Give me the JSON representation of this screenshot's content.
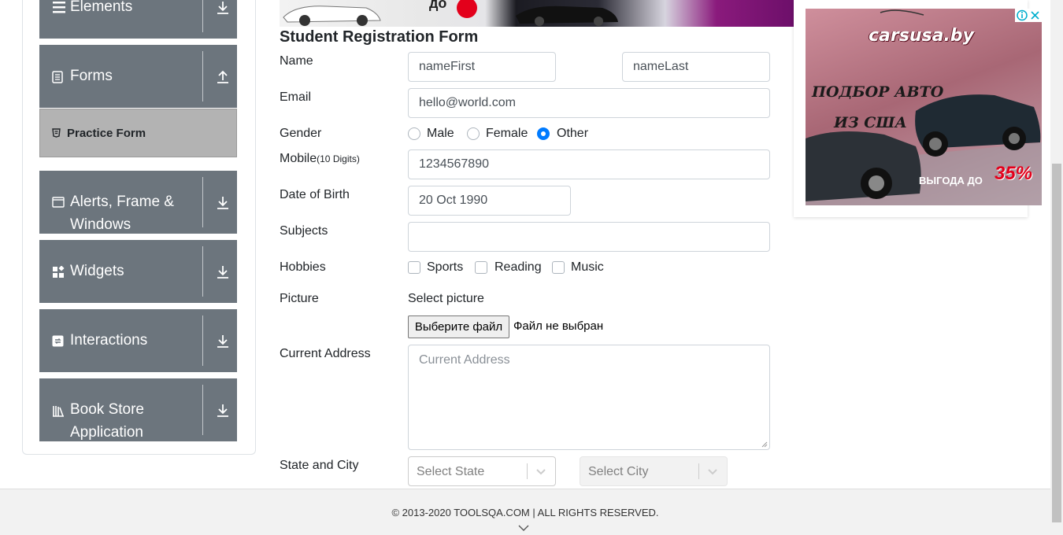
{
  "sidebar": {
    "groups": [
      {
        "label": "Elements",
        "icon": "menu-icon",
        "arrow": "download-arrow-icon"
      },
      {
        "label": "Forms",
        "icon": "document-icon",
        "arrow": "upload-arrow-icon"
      },
      {
        "label": "Alerts, Frame &",
        "label2": "Windows",
        "icon": "window-icon",
        "arrow": "download-arrow-icon"
      },
      {
        "label": "Widgets",
        "icon": "widgets-icon",
        "arrow": "download-arrow-icon"
      },
      {
        "label": "Interactions",
        "icon": "interactions-icon",
        "arrow": "download-arrow-icon"
      },
      {
        "label": "Book Store",
        "label2": "Application",
        "icon": "books-icon",
        "arrow": "download-arrow-icon"
      }
    ],
    "active_item": "Practice Form"
  },
  "form": {
    "title": "Student Registration Form",
    "name_label": "Name",
    "first_name": "nameFirst",
    "last_name": "nameLast",
    "email_label": "Email",
    "email": "hello@world.com",
    "gender_label": "Gender",
    "gender_options": [
      "Male",
      "Female",
      "Other"
    ],
    "gender_selected": "Other",
    "mobile_label": "Mobile",
    "mobile_hint": "(10 Digits)",
    "mobile": "1234567890",
    "dob_label": "Date of Birth",
    "dob": "20 Oct 1990",
    "subjects_label": "Subjects",
    "subjects": "",
    "hobbies_label": "Hobbies",
    "hobbies": [
      "Sports",
      "Reading",
      "Music"
    ],
    "picture_label": "Picture",
    "picture_prompt": "Select picture",
    "file_button": "Выберите файл",
    "file_status": "Файл не выбран",
    "address_label": "Current Address",
    "address_placeholder": "Current Address",
    "state_city_label": "State and City",
    "state_placeholder": "Select State",
    "city_placeholder": "Select City"
  },
  "ad": {
    "brand": "carsusa.by",
    "line1": "ПОДБОР АВТО",
    "line2": "ИЗ США",
    "line3": "ВЫГОДА ДО",
    "line4": "35%",
    "banner_text": "до"
  },
  "footer": {
    "copyright": "© 2013-2020 TOOLSQA.COM | ALL RIGHTS RESERVED."
  },
  "colors": {
    "sidebar_bg": "#6c757d",
    "active_bg": "#b3b3b3",
    "radio_accent": "#007bff",
    "footer_bg": "#f2f2f2"
  }
}
